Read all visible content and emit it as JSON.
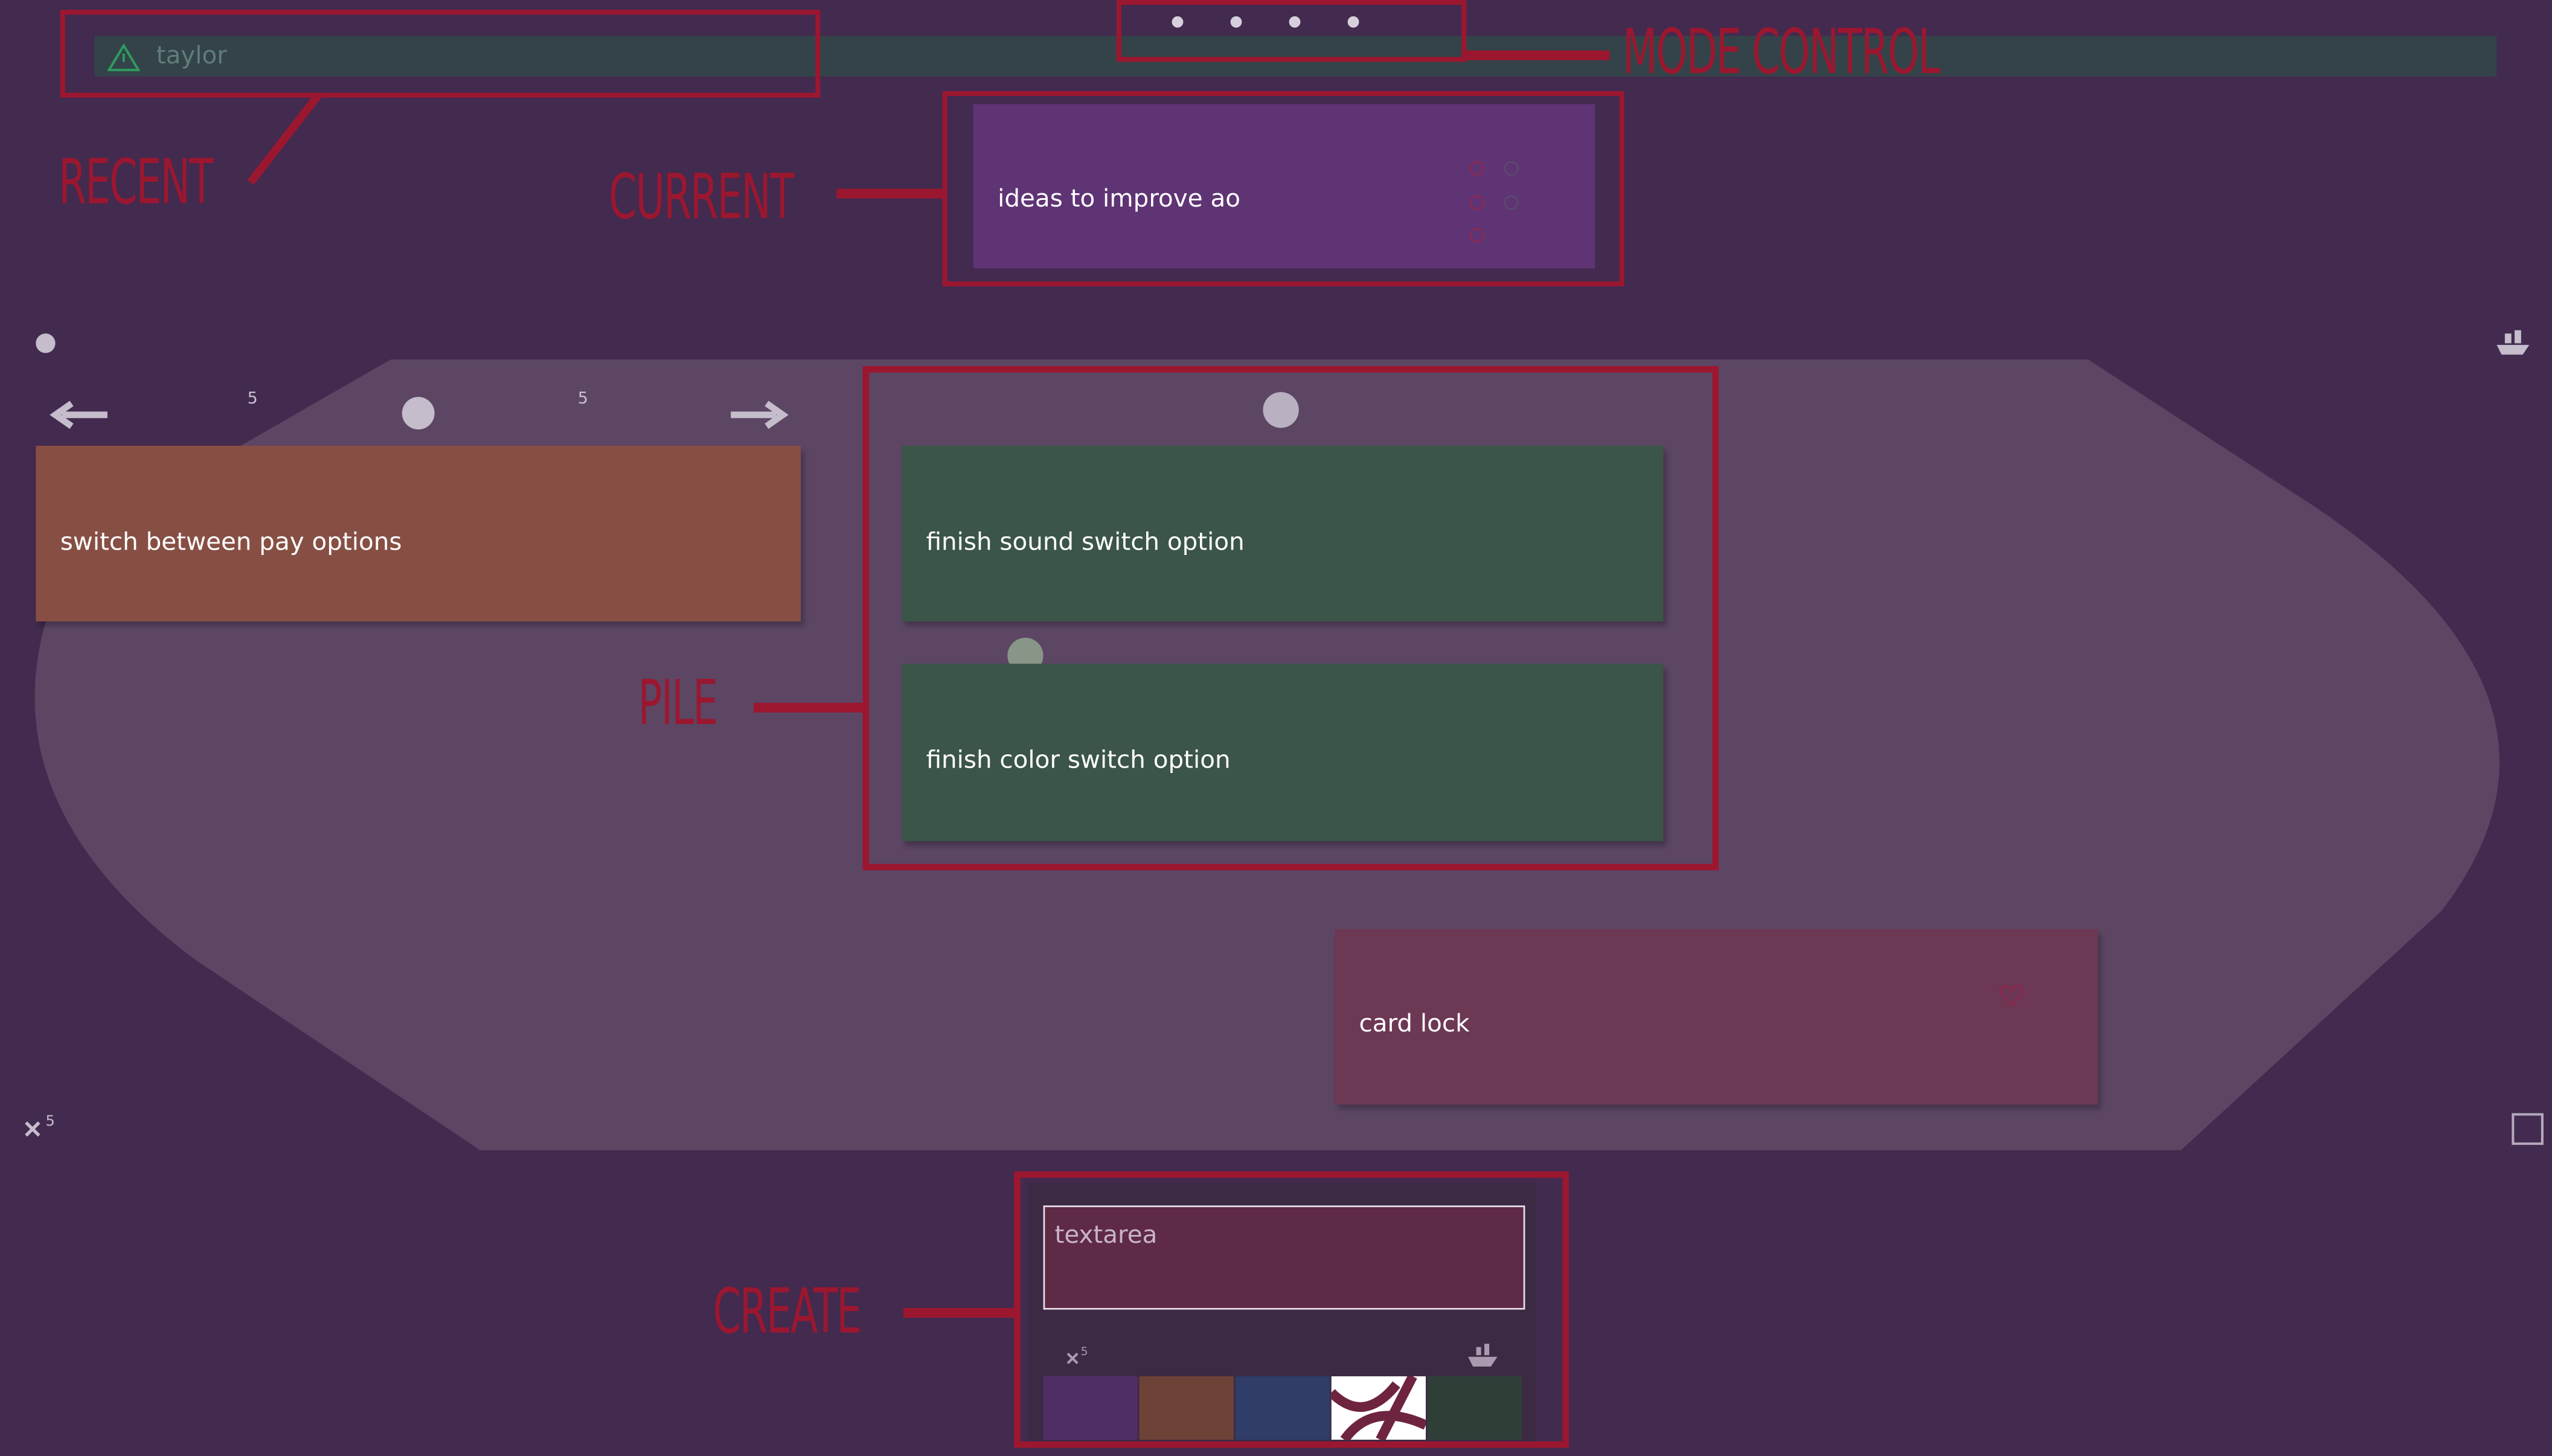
{
  "recent": {
    "username": "taylor"
  },
  "mode_control": {
    "dot_count": 4
  },
  "current": {
    "title": "ideas to improve ao"
  },
  "pile": {
    "cards": [
      {
        "label": "switch between pay options",
        "color": "#874f44"
      },
      {
        "label": "finish sound switch option",
        "color": "#3b5548"
      },
      {
        "label": "finish color switch option",
        "color": "#3b5548"
      },
      {
        "label": "card lock",
        "color": "#6c3854"
      }
    ],
    "badges": {
      "left_count": "5",
      "right_count": "5"
    }
  },
  "create": {
    "textarea_placeholder": "textarea",
    "swatches": [
      "#4f2e66",
      "#6e4236",
      "#2f3d68",
      "#ffffff",
      "#2f3f38"
    ]
  },
  "annotations": {
    "recent": "RECENT",
    "current": "CURRENT",
    "mode_control": "MODE CONTROL",
    "pile": "PILE",
    "create": "CREATE"
  },
  "colors": {
    "background": "#432a4f",
    "annotation": "#9b1730",
    "pile_region": "#5c4664"
  }
}
